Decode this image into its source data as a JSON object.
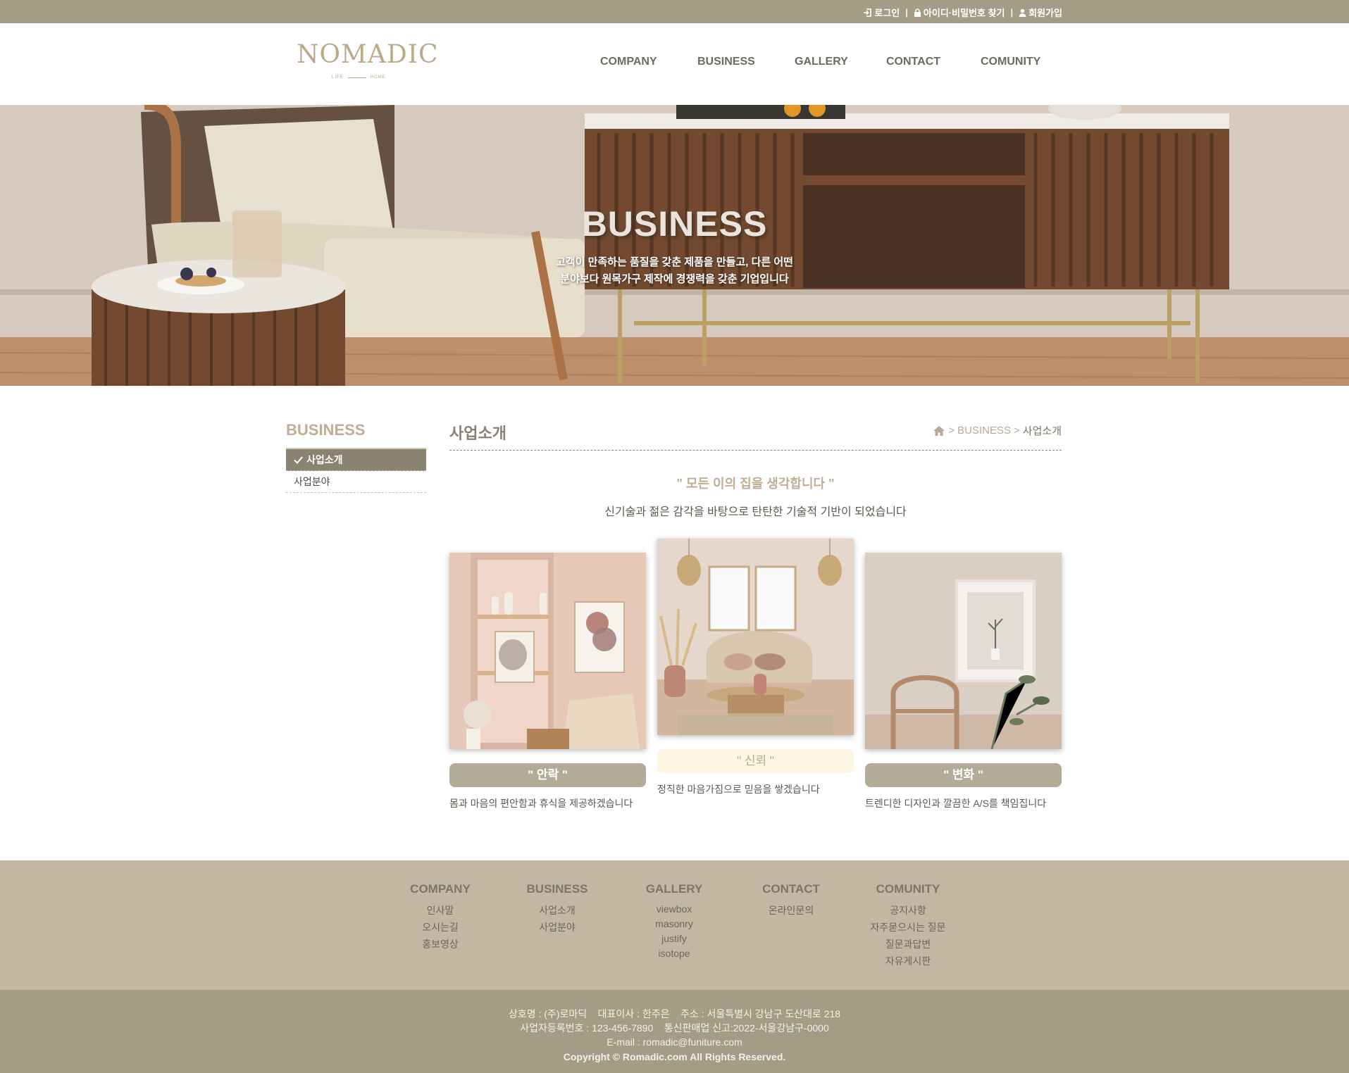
{
  "topbar": {
    "login": "로그인",
    "find": "아이디·비밀번호 찾기",
    "join": "회원가입",
    "sep": "|",
    "bg_color": "#a59c86"
  },
  "header": {
    "logo_word": "NOMADIC",
    "logo_left": "LIFE",
    "logo_right": "HOME",
    "nav": [
      "COMPANY",
      "BUSINESS",
      "GALLERY",
      "CONTACT",
      "COMUNITY"
    ]
  },
  "hero": {
    "title": "BUSINESS",
    "sub1": "고객이 만족하는 품질을 갖춘 제품을 만들고, 다른 어떤",
    "sub2": "분야보다 원목가구 제작에 경쟁력을 갖춘 기업입니다"
  },
  "sidebar": {
    "title": "BUSINESS",
    "items": [
      "사업소개",
      "사업분야"
    ]
  },
  "main": {
    "title": "사업소개",
    "breadcrumb": {
      "sep1": ">",
      "section": "BUSINESS",
      "sep2": ">",
      "current": "사업소개"
    },
    "quote": "\" 모든 이의 집을 생각합니다 \"",
    "lead": "신기술과 젊은 감각을 바탕으로 탄탄한 기술적 기반이 되었습니다",
    "cards": [
      {
        "label": "\" 안락 \"",
        "desc": "몸과 마음의 편안함과 휴식을 제공하겠습니다"
      },
      {
        "label": "\" 신뢰 \"",
        "desc": "정직한 마음가짐으로 믿음을 쌓겠습니다"
      },
      {
        "label": "\" 변화 \"",
        "desc": "트렌디한 디자인과 깔끔한 A/S를 책임집니다"
      }
    ]
  },
  "footer_nav": {
    "company": {
      "title": "COMPANY",
      "items": [
        "인사말",
        "오시는길",
        "홍보영상"
      ]
    },
    "business": {
      "title": "BUSINESS",
      "items": [
        "사업소개",
        "사업분야"
      ]
    },
    "gallery": {
      "title": "GALLERY",
      "items": [
        "viewbox",
        "masonry",
        "justify",
        "isotope"
      ]
    },
    "contact": {
      "title": "CONTACT",
      "items": [
        "온라인문의"
      ]
    },
    "comunity": {
      "title": "COMUNITY",
      "items": [
        "공지사항",
        "자주묻으시는 질문",
        "질문과답변",
        "자유게시판"
      ]
    }
  },
  "footer_info": {
    "line1": "상호명 : (주)로마딕    대표이사 : 한주은    주소 : 서울특별시 강남구 도산대로 218",
    "line2": "사업자등록번호 : 123-456-7890    통신판매업 신고:2022-서울강남구-0000",
    "line3": "E-mail : romadic@funiture.com",
    "copyright": "Copyright © Romadic.com All Rights Reserved."
  },
  "icons": [
    "sign-in-icon",
    "lock-icon",
    "user-icon",
    "home-icon",
    "check-icon"
  ]
}
